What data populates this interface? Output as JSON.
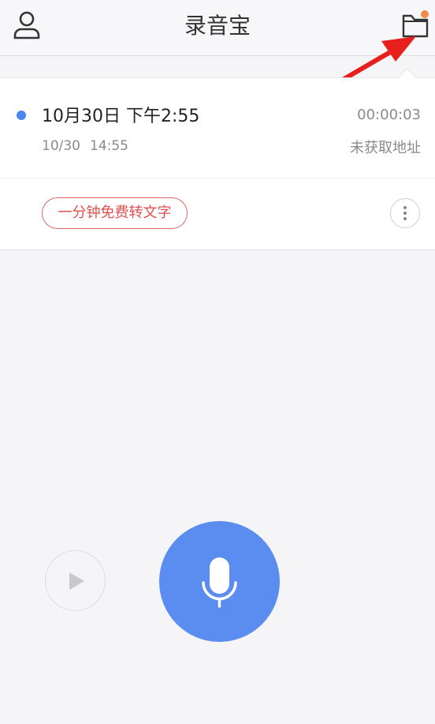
{
  "header": {
    "title": "录音宝"
  },
  "icons": {
    "user": "user-icon",
    "folder": "folder-icon",
    "more": "more-vertical-icon",
    "play": "play-icon",
    "mic": "microphone-icon"
  },
  "recording": {
    "title": "10月30日 下午2:55",
    "duration": "00:00:03",
    "date": "10/30",
    "time": "14:55",
    "location": "未获取地址"
  },
  "actions": {
    "transcribe_label": "一分钟免费转文字"
  },
  "colors": {
    "accent": "#5b8cf0",
    "dot": "#4a86f0",
    "transcribe": "#e0504f",
    "notification": "#f08a4b",
    "annotation_arrow": "#e8201d"
  }
}
